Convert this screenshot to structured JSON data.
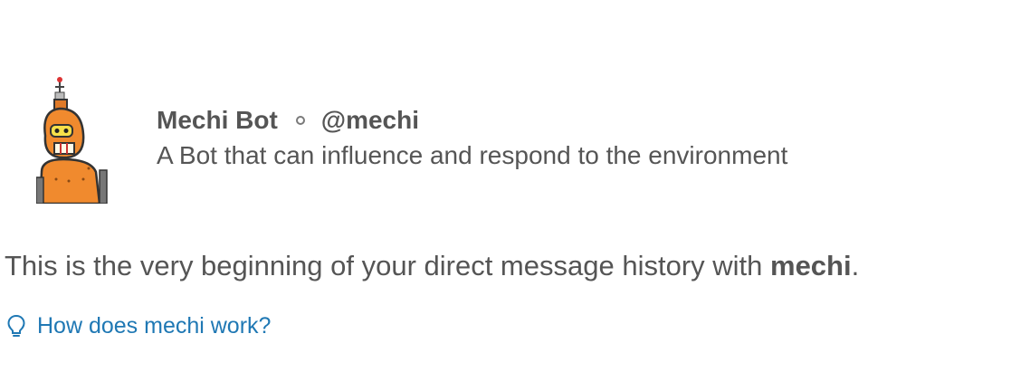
{
  "profile": {
    "name": "Mechi Bot",
    "handle": "@mechi",
    "description": "A Bot that can influence and respond to the environment",
    "avatar_icon": "robot-avatar-icon",
    "presence_icon": "presence-away-icon"
  },
  "intro": {
    "prefix": "This is the very beginning of your direct message history with ",
    "name": "mechi",
    "suffix": "."
  },
  "help": {
    "icon": "lightbulb-icon",
    "link_text": "How does mechi work?"
  },
  "colors": {
    "text": "#555555",
    "link": "#1f78b4",
    "avatar_orange": "#f08a2e"
  }
}
